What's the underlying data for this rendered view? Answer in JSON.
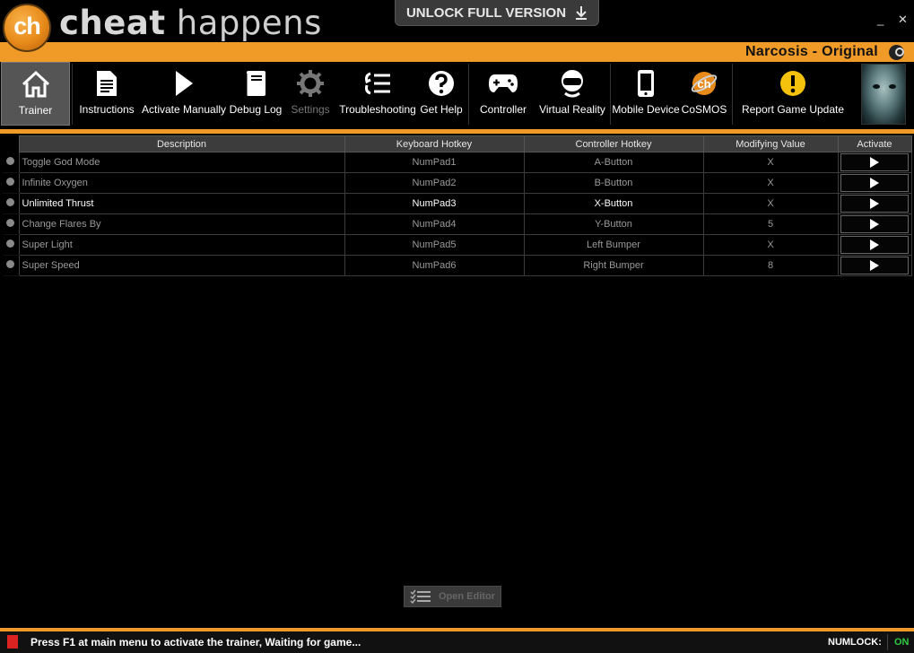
{
  "app": {
    "logo_badge": "ch",
    "logo_word1": "cheat",
    "logo_word2": " happens",
    "unlock_label": "UNLOCK FULL VERSION",
    "minimize_glyph": "_",
    "close_glyph": "✕"
  },
  "game": {
    "title": "Narcosis - Original"
  },
  "toolbar": {
    "items": [
      {
        "label": "Trainer",
        "icon": "home-icon"
      },
      {
        "label": "Instructions",
        "icon": "document-icon"
      },
      {
        "label": "Activate Manually",
        "icon": "play-icon"
      },
      {
        "label": "Debug Log",
        "icon": "notebook-icon"
      },
      {
        "label": "Settings",
        "icon": "gear-icon"
      },
      {
        "label": "Troubleshooting",
        "icon": "list-icon"
      },
      {
        "label": "Get Help",
        "icon": "help-icon"
      },
      {
        "label": "Controller",
        "icon": "gamepad-icon"
      },
      {
        "label": "Virtual Reality",
        "icon": "vr-headset-icon"
      },
      {
        "label": "Mobile Device",
        "icon": "phone-icon"
      },
      {
        "label": "CoSMOS",
        "icon": "cosmos-icon"
      },
      {
        "label": "Report Game Update",
        "icon": "warning-icon"
      }
    ]
  },
  "table": {
    "headers": [
      "Description",
      "Keyboard Hotkey",
      "Controller Hotkey",
      "Modifying Value",
      "Activate"
    ],
    "rows": [
      {
        "desc": "Toggle God Mode",
        "key": "NumPad1",
        "ctrl": "A-Button",
        "value": "X"
      },
      {
        "desc": "Infinite Oxygen",
        "key": "NumPad2",
        "ctrl": "B-Button",
        "value": "X"
      },
      {
        "desc": "Unlimited Thrust",
        "key": "NumPad3",
        "ctrl": "X-Button",
        "value": "X"
      },
      {
        "desc": "Change Flares By",
        "key": "NumPad4",
        "ctrl": "Y-Button",
        "value": "5"
      },
      {
        "desc": "Super Light",
        "key": "NumPad5",
        "ctrl": "Left Bumper",
        "value": "X"
      },
      {
        "desc": "Super Speed",
        "key": "NumPad6",
        "ctrl": "Right Bumper",
        "value": "8"
      }
    ]
  },
  "editor": {
    "label": "Open Editor"
  },
  "status": {
    "message": "Press F1 at main menu to activate the trainer, Waiting for game...",
    "numlock_label": "NUMLOCK:",
    "numlock_value": "ON"
  }
}
